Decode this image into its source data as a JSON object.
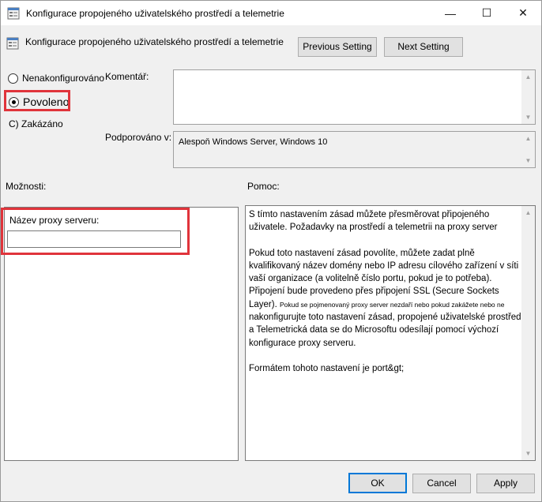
{
  "window": {
    "title": "Konfigurace propojeného uživatelského prostředí a telemetrie",
    "minimize": "—",
    "maximize": "☐",
    "close": "✕"
  },
  "header": {
    "title": "Konfigurace propojeného uživatelského prostředí a telemetrie",
    "prev_label": "Previous Setting",
    "next_label": "Next Setting"
  },
  "state": {
    "not_configured": "Nenakonfigurováno",
    "enabled": "Povoleno",
    "disabled": "C) Zakázáno",
    "selected": "enabled"
  },
  "comment": {
    "label": "Komentář:",
    "value": ""
  },
  "supported": {
    "label": "Podporováno v:",
    "value": "Alespoň Windows Server, Windows 10"
  },
  "options": {
    "label": "Možnosti:",
    "proxy_label": "Název proxy serveru:",
    "proxy_value": ""
  },
  "help": {
    "label": "Pomoc:",
    "p1": "S tímto nastavením zásad můžete přesměrovat připojeného uživatele. Požadavky na prostředí a telemetrii na proxy server",
    "p2a": "Pokud toto nastavení zásad povolíte, můžete zadat plně kvalifikovaný název domény nebo IP adresu cílového zařízení v síti vaší organizace (a volitelně číslo portu, pokud je to potřeba).",
    "p2b": "Připojení bude provedeno přes připojení SSL (Secure Sockets Layer).",
    "p2c": "Pokud se pojmenovaný proxy server nezdaří nebo pokud zakážete nebo ne",
    "p2d": "nakonfigurujte toto nastavení zásad, propojené uživatelské prostředí a Telemetrická data se do Microsoftu odesílají pomocí výchozí konfigurace proxy serveru.",
    "p3": "Formátem tohoto nastavení je port&gt;"
  },
  "footer": {
    "ok": "OK",
    "cancel": "Cancel",
    "apply": "Apply"
  },
  "colors": {
    "highlight": "#e0343b",
    "default_button_border": "#0078d7"
  }
}
